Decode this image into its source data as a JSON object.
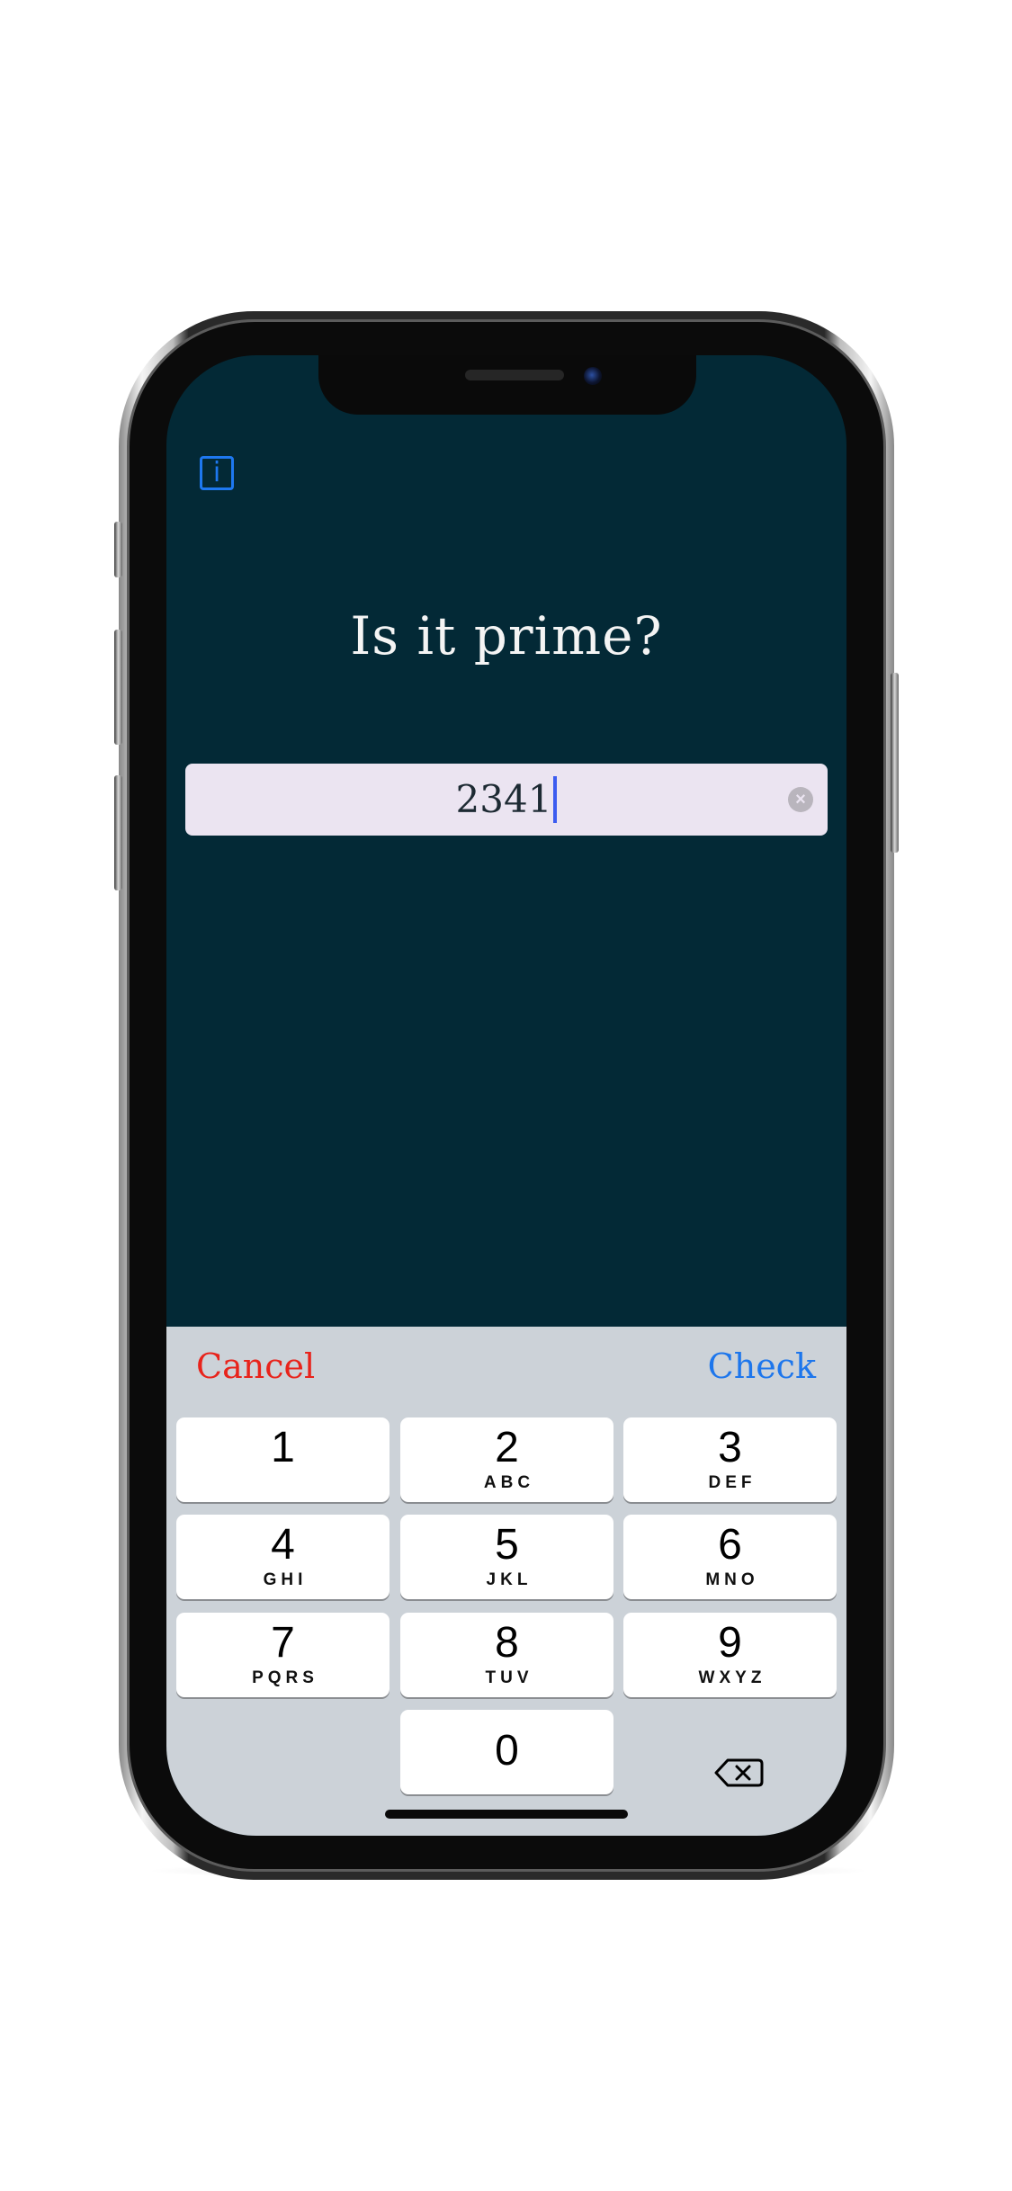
{
  "app": {
    "title": "Is it prime?",
    "info_icon": "i",
    "info_icon_name": "info-icon"
  },
  "input": {
    "value": "2341",
    "clear_icon": "×"
  },
  "accessory": {
    "cancel_label": "Cancel",
    "check_label": "Check"
  },
  "keypad": {
    "keys": [
      {
        "digit": "1",
        "letters": ""
      },
      {
        "digit": "2",
        "letters": "ABC"
      },
      {
        "digit": "3",
        "letters": "DEF"
      },
      {
        "digit": "4",
        "letters": "GHI"
      },
      {
        "digit": "5",
        "letters": "JKL"
      },
      {
        "digit": "6",
        "letters": "MNO"
      },
      {
        "digit": "7",
        "letters": "PQRS"
      },
      {
        "digit": "8",
        "letters": "TUV"
      },
      {
        "digit": "9",
        "letters": "WXYZ"
      },
      {
        "digit": "0",
        "letters": ""
      }
    ],
    "delete_icon": "backspace-icon"
  },
  "colors": {
    "background": "#032936",
    "field": "#ebe4f1",
    "cancel": "#e8231b",
    "check": "#1d76ec",
    "info": "#1e78f0",
    "keyboard": "#ccd2d8"
  }
}
